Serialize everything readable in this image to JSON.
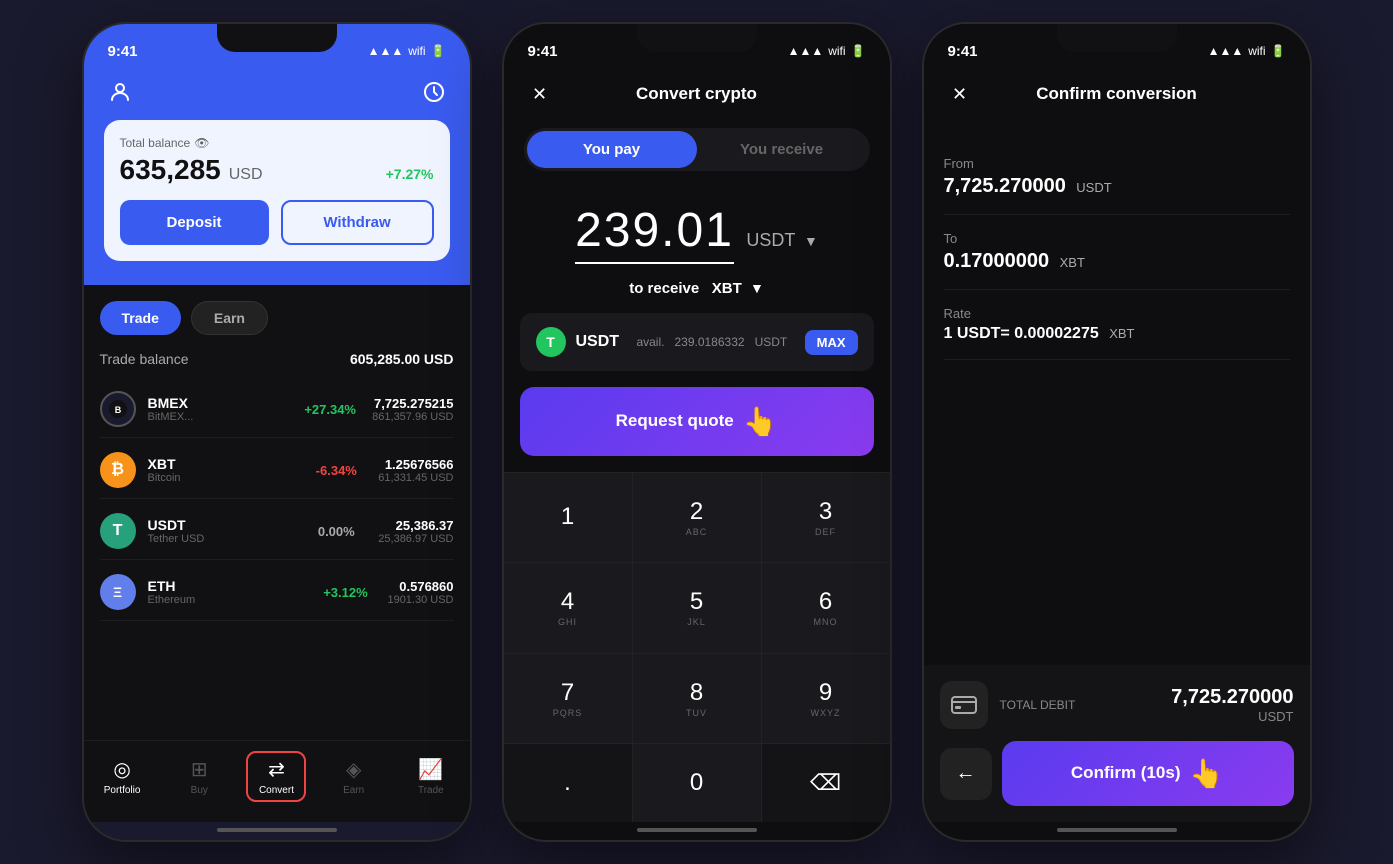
{
  "phone1": {
    "status": {
      "time": "9:41"
    },
    "hero": {
      "balance_label": "Total balance",
      "balance_amount": "635,285",
      "balance_currency": "USD",
      "balance_change": "+7.27%",
      "deposit_label": "Deposit",
      "withdraw_label": "Withdraw"
    },
    "tabs": {
      "trade_label": "Trade",
      "earn_label": "Earn"
    },
    "trade_balance": {
      "label": "Trade balance",
      "value": "605,285.00 USD"
    },
    "assets": [
      {
        "symbol": "BMEX",
        "name": "BitMEX...",
        "change": "+27.34%",
        "balance": "7,725.275215",
        "usd": "861,357.96 USD",
        "color": "#1a1a2e",
        "letter": "B",
        "positive": true
      },
      {
        "symbol": "XBT",
        "name": "Bitcoin",
        "change": "-6.34%",
        "balance": "1.25676566",
        "usd": "61,331.45 USD",
        "color": "#f7931a",
        "letter": "₿",
        "positive": false
      },
      {
        "symbol": "USDT",
        "name": "Tether USD",
        "change": "0.00%",
        "balance": "25,386.37",
        "usd": "25,386.97 USD",
        "color": "#26a17b",
        "letter": "T",
        "neutral": true
      },
      {
        "symbol": "ETH",
        "name": "Ethereum",
        "change": "+3.12%",
        "balance": "0.576860",
        "usd": "1901.30 USD",
        "color": "#627eea",
        "letter": "Ξ",
        "positive": true
      }
    ],
    "nav": {
      "portfolio": "Portfolio",
      "buy": "Buy",
      "convert": "Convert",
      "earn": "Earn",
      "trade": "Trade"
    }
  },
  "phone2": {
    "status": {
      "time": "9:41"
    },
    "title": "Convert crypto",
    "tabs": {
      "you_pay": "You pay",
      "you_receive": "You receive"
    },
    "amount": "239.01",
    "amount_currency": "USDT",
    "receive_label": "to receive",
    "receive_currency": "XBT",
    "currency_row": {
      "icon_letter": "T",
      "name": "USDT",
      "avail_label": "avail.",
      "avail_amount": "239.0186332",
      "avail_currency": "USDT",
      "max_label": "MAX"
    },
    "request_quote": "Request quote",
    "numpad": [
      {
        "num": "1",
        "letters": ""
      },
      {
        "num": "2",
        "letters": "ABC"
      },
      {
        "num": "3",
        "letters": "DEF"
      },
      {
        "num": "4",
        "letters": "GHI"
      },
      {
        "num": "5",
        "letters": "JKL"
      },
      {
        "num": "6",
        "letters": "MNO"
      },
      {
        "num": "7",
        "letters": "PQRS"
      },
      {
        "num": "8",
        "letters": "TUV"
      },
      {
        "num": "9",
        "letters": "WXYZ"
      },
      {
        "num": ".",
        "letters": ""
      },
      {
        "num": "0",
        "letters": ""
      },
      {
        "num": "⌫",
        "letters": ""
      }
    ]
  },
  "phone3": {
    "status": {
      "time": "9:41"
    },
    "title": "Confirm conversion",
    "from_label": "From",
    "from_amount": "7,725.270000",
    "from_currency": "USDT",
    "to_label": "To",
    "to_amount": "0.17000000",
    "to_currency": "XBT",
    "rate_label": "Rate",
    "rate_value": "1 USDT=",
    "rate_amount": "0.00002275",
    "rate_currency": "XBT",
    "debit_label": "TOTAL DEBIT",
    "debit_amount": "7,725.270000",
    "debit_currency": "USDT",
    "back_icon": "←",
    "confirm_label": "Confirm (10s)"
  }
}
